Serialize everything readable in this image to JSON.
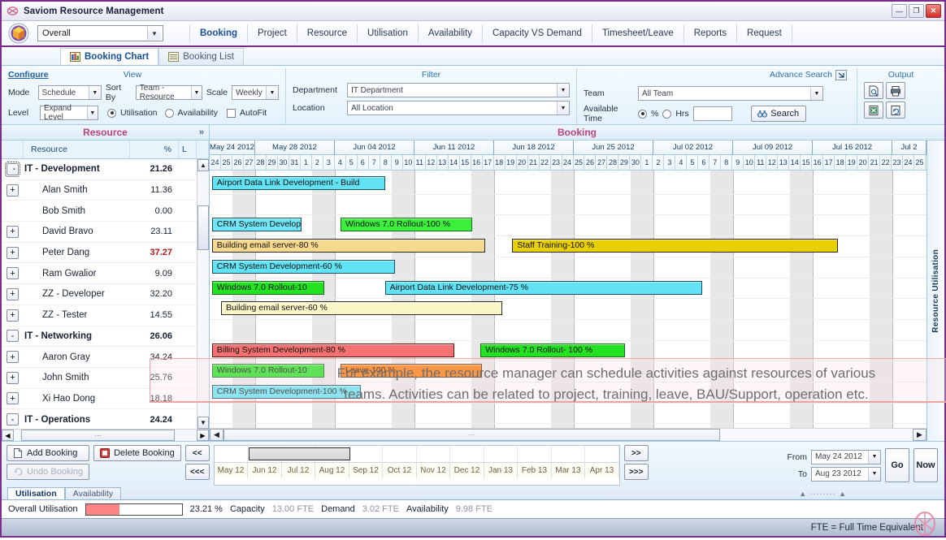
{
  "window": {
    "title": "Saviom Resource Management",
    "icon": "saviom-logo-icon",
    "minimize": "—",
    "maximize": "❐",
    "close": "✕"
  },
  "nav": {
    "scope_select": "Overall",
    "items": [
      {
        "label": "Booking",
        "active": true
      },
      {
        "label": "Project",
        "active": false
      },
      {
        "label": "Resource",
        "active": false
      },
      {
        "label": "Utilisation",
        "active": false
      },
      {
        "label": "Availability",
        "active": false
      },
      {
        "label": "Capacity VS Demand",
        "active": false
      },
      {
        "label": "Timesheet/Leave",
        "active": false
      },
      {
        "label": "Reports",
        "active": false
      },
      {
        "label": "Request",
        "active": false
      }
    ]
  },
  "subtabs": [
    {
      "label": "Booking Chart",
      "active": true,
      "icon": "chart-icon"
    },
    {
      "label": "Booking List",
      "active": false,
      "icon": "list-icon"
    }
  ],
  "configure": {
    "title": "Configure",
    "view_title": "View",
    "mode_label": "Mode",
    "mode_value": "Schedule",
    "level_label": "Level",
    "level_value": "Expand Level",
    "sortby_label": "Sort By",
    "sortby_value": "Team - Resource",
    "scale_label": "Scale",
    "scale_value": "Weekly",
    "utilisation_label": "Utilisation",
    "availability_label": "Availability",
    "autofit_label": "AutoFit"
  },
  "filter": {
    "title": "Filter",
    "department_label": "Department",
    "department_value": "IT Department",
    "location_label": "Location",
    "location_value": "All Location",
    "team_label": "Team",
    "team_value": "All Team",
    "available_time_label": "Available Time",
    "pct_label": "%",
    "hrs_label": "Hrs",
    "hrs_value": "",
    "advance_search": "Advance Search",
    "search_button": "Search"
  },
  "output": {
    "title": "Output",
    "buttons": [
      "preview-icon",
      "print-icon",
      "excel-icon",
      "refresh-icon"
    ]
  },
  "bands": {
    "resource": "Resource",
    "booking": "Booking",
    "expand_chevron": "»"
  },
  "resource_grid": {
    "columns": [
      "",
      "Resource",
      "%",
      "L"
    ],
    "rows": [
      {
        "expander": "-",
        "name": "IT - Development",
        "pct": "21.26",
        "group": true,
        "selected": true
      },
      {
        "expander": "+",
        "name": "Alan Smith",
        "pct": "11.36",
        "group": false,
        "selected": false
      },
      {
        "expander": "",
        "name": "Bob Smith",
        "pct": "0.00",
        "group": false,
        "selected": false
      },
      {
        "expander": "+",
        "name": "David Bravo",
        "pct": "23.11",
        "group": false,
        "selected": false
      },
      {
        "expander": "+",
        "name": "Peter Dang",
        "pct": "37.27",
        "group": false,
        "selected": false,
        "hot": true
      },
      {
        "expander": "+",
        "name": "Ram Gwalior",
        "pct": "9.09",
        "group": false,
        "selected": false
      },
      {
        "expander": "+",
        "name": "ZZ - Developer",
        "pct": "32.20",
        "group": false,
        "selected": false
      },
      {
        "expander": "+",
        "name": "ZZ - Tester",
        "pct": "14.55",
        "group": false,
        "selected": false
      },
      {
        "expander": "-",
        "name": "IT - Networking",
        "pct": "26.06",
        "group": true,
        "selected": false
      },
      {
        "expander": "+",
        "name": "Aaron Gray",
        "pct": "34.24",
        "group": false,
        "selected": false
      },
      {
        "expander": "+",
        "name": "John Smith",
        "pct": "25.76",
        "group": false,
        "selected": false
      },
      {
        "expander": "+",
        "name": "Xi Hao Dong",
        "pct": "18.18",
        "group": false,
        "selected": false
      },
      {
        "expander": "-",
        "name": "IT - Operations",
        "pct": "24.24",
        "group": true,
        "selected": false
      }
    ]
  },
  "gantt": {
    "weeks": [
      {
        "label": "May 24 2012",
        "days": [
          "24",
          "25",
          "26",
          "27"
        ]
      },
      {
        "label": "May 28 2012",
        "days": [
          "28",
          "29",
          "30",
          "31",
          "1",
          "2",
          "3"
        ]
      },
      {
        "label": "Jun 04 2012",
        "days": [
          "4",
          "5",
          "6",
          "7",
          "8",
          "9",
          "10"
        ]
      },
      {
        "label": "Jun 11 2012",
        "days": [
          "11",
          "12",
          "13",
          "14",
          "15",
          "16",
          "17"
        ]
      },
      {
        "label": "Jun 18 2012",
        "days": [
          "18",
          "19",
          "20",
          "21",
          "22",
          "23",
          "24"
        ]
      },
      {
        "label": "Jun 25 2012",
        "days": [
          "25",
          "26",
          "27",
          "28",
          "29",
          "30",
          "1"
        ]
      },
      {
        "label": "Jul 02 2012",
        "days": [
          "2",
          "3",
          "4",
          "5",
          "6",
          "7",
          "8"
        ]
      },
      {
        "label": "Jul 09 2012",
        "days": [
          "9",
          "10",
          "11",
          "12",
          "13",
          "14",
          "15"
        ]
      },
      {
        "label": "Jul 16 2012",
        "days": [
          "16",
          "17",
          "18",
          "19",
          "20",
          "21",
          "22"
        ]
      },
      {
        "label": "Jul 2",
        "days": [
          "23",
          "24",
          "25"
        ]
      }
    ],
    "bars": [
      {
        "label": "Airport Data Link Development - Build",
        "row": 1,
        "start": 0.2,
        "end": 15.4,
        "fill": "#62e3f5",
        "border": "#1b4d63"
      },
      {
        "label": "CRM System Development-",
        "row": 3,
        "start": 0.2,
        "end": 8.1,
        "fill": "#6fe6f7",
        "border": "#1b4d63"
      },
      {
        "label": "Windows 7.0 Rollout-100 %",
        "row": 3,
        "start": 11.5,
        "end": 23.1,
        "fill": "#3bf03b",
        "border": "#1c6b1c"
      },
      {
        "label": "Building email server-80 %",
        "row": 4,
        "start": 0.2,
        "end": 24.2,
        "fill": "#f6d98e",
        "border": "#2b2b2b"
      },
      {
        "label": "Staff Training-100 %",
        "row": 4,
        "start": 26.6,
        "end": 55.2,
        "fill": "#e8cf00",
        "border": "#2b2b2b"
      },
      {
        "label": "CRM System Development-60 %",
        "row": 5,
        "start": 0.2,
        "end": 16.3,
        "fill": "#62e3f5",
        "border": "#1b4d63"
      },
      {
        "label": "Windows 7.0 Rollout-10",
        "row": 6,
        "start": 0.2,
        "end": 10.1,
        "fill": "#22e222",
        "border": "#1c6b1c"
      },
      {
        "label": "Airport Data Link Development-75 %",
        "row": 6,
        "start": 15.4,
        "end": 43.3,
        "fill": "#62e3f5",
        "border": "#1b4d63"
      },
      {
        "label": "Building email server-60 %",
        "row": 7,
        "start": 1.0,
        "end": 25.7,
        "fill": "#f9f6c8",
        "border": "#2b2b2b"
      },
      {
        "label": "Billing System Development-80 %",
        "row": 9,
        "start": 0.2,
        "end": 21.5,
        "fill": "#f67272",
        "border": "#5a1515"
      },
      {
        "label": "Windows 7.0 Rollout- 100 %",
        "row": 9,
        "start": 23.8,
        "end": 36.5,
        "fill": "#22e222",
        "border": "#1c6b1c"
      },
      {
        "label": "Windows 7.0 Rollout-10",
        "row": 10,
        "start": 0.2,
        "end": 10.1,
        "fill": "#22e222",
        "border": "#1c6b1c"
      },
      {
        "label": "Leave-100 %",
        "row": 10,
        "start": 11.5,
        "end": 23.9,
        "fill": "#fa7a0a",
        "border": "#5a2a05"
      },
      {
        "label": "CRM System Development-100 %",
        "row": 11,
        "start": 0.2,
        "end": 13.3,
        "fill": "#62e3f5",
        "border": "#1b4d63"
      }
    ],
    "vertical_label": "Resource Utilisation"
  },
  "overlay": {
    "line1": "For example, the resource manager can schedule activities against resources of various",
    "line2": "teams. Activities can be related to project, training, leave, BAU/Support, operation etc."
  },
  "bottom": {
    "add_booking": "Add Booking",
    "delete_booking": "Delete Booking",
    "undo_booking": "Undo Booking",
    "prev": "<<",
    "prev_fast": "<<<",
    "next": ">>",
    "next_fast": ">>>",
    "months": [
      "May 12",
      "Jun 12",
      "Jul 12",
      "Aug 12",
      "Sep 12",
      "Oct 12",
      "Nov 12",
      "Dec 12",
      "Jan 13",
      "Feb 13",
      "Mar 13",
      "Apr 13"
    ],
    "from_label": "From",
    "from_value": "May 24 2012",
    "to_label": "To",
    "to_value": "Aug 23 2012",
    "go": "Go",
    "now": "Now"
  },
  "status": {
    "tabs": [
      {
        "label": "Utilisation",
        "active": true
      },
      {
        "label": "Availability",
        "active": false
      }
    ],
    "overall_label": "Overall Utilisation",
    "overall_pct": "23.21 %",
    "meter_fill_pct": 35,
    "meter_color": "#ff8585",
    "capacity_label": "Capacity",
    "capacity_value": "13.00 FTE",
    "demand_label": "Demand",
    "demand_value": "3.02 FTE",
    "availability_label": "Availability",
    "availability_value": "9.98 FTE",
    "footer_note": "FTE = Full Time Equivalent"
  }
}
